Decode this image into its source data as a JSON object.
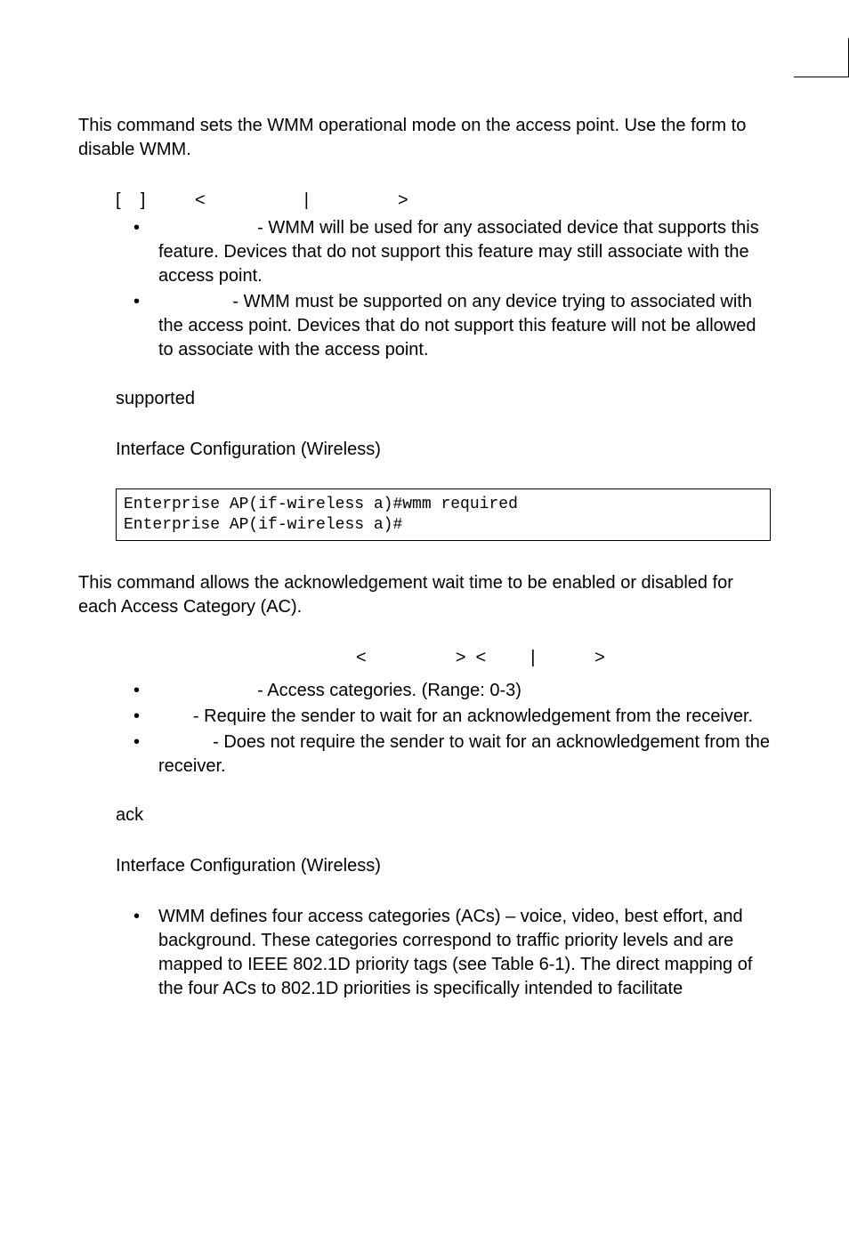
{
  "intro1": "This command sets the WMM operational mode on the access point. Use the form to disable WMM.",
  "syntax1_open": "[",
  "syntax1_close": "]",
  "syntax1_lt": "<",
  "syntax1_pipe": "|",
  "syntax1_gt": ">",
  "wmm_b1": "- WMM will be used for any associated device that supports this feature. Devices that do not support this feature may still associate with the access point.",
  "wmm_b2": "- WMM must be supported on any device trying to associated with the access point. Devices that do not support this feature will not be allowed to associate with the access point.",
  "default1": "supported",
  "mode1": "Interface Configuration (Wireless)",
  "code1": "Enterprise AP(if-wireless a)#wmm required\nEnterprise AP(if-wireless a)#",
  "intro2": "This command allows the acknowledgement wait time to be enabled or disabled for each Access Category (AC).",
  "syntax2_lt1": "<",
  "syntax2_gt1": ">",
  "syntax2_lt2": "<",
  "syntax2_pipe": "|",
  "syntax2_gt2": ">",
  "ac_b1": "- Access categories. (Range: 0-3)",
  "ac_b2": "- Require the sender to wait for an acknowledgement from the receiver.",
  "ac_b3": "- Does not require the sender to wait for an acknowledgement from the receiver.",
  "default2": "ack",
  "mode2": "Interface Configuration (Wireless)",
  "usage_b1": "WMM defines four access categories (ACs) – voice, video, best effort, and background. These categories correspond to traffic priority levels and are mapped to IEEE 802.1D priority tags (see Table 6-1). The direct mapping of the four ACs to 802.1D priorities is specifically intended to facilitate"
}
